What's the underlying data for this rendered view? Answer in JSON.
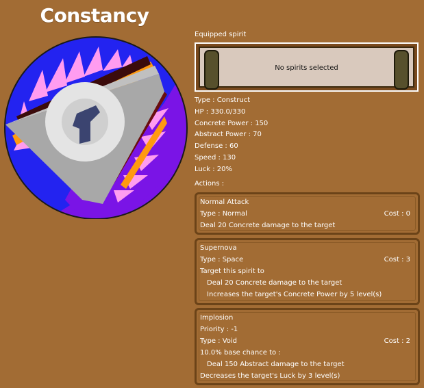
{
  "title": "Constancy",
  "equipped": {
    "label": "Equipped spirit",
    "empty_text": "No spirits selected"
  },
  "stats": {
    "type": "Type : Construct",
    "hp": "HP : 330.0/330",
    "concrete_power": "Concrete Power : 150",
    "abstract_power": "Abstract Power : 70",
    "defense": "Defense : 60",
    "speed": "Speed : 130",
    "luck": "Luck : 20%"
  },
  "actions_label": "Actions :",
  "actions": [
    {
      "name": "Normal Attack",
      "type": "Type : Normal",
      "cost": "Cost : 0",
      "description": "Deal 20 Concrete damage to the target"
    },
    {
      "name": "Supernova",
      "type": "Type : Space",
      "cost": "Cost : 3",
      "target": "Target this spirit to",
      "effect1": "Deal 20 Concrete damage to the target",
      "effect2": "Increases the target's Concrete Power by 5 level(s)"
    },
    {
      "name": "Implosion",
      "priority": "Priority : -1",
      "type": "Type : Void",
      "cost": "Cost : 2",
      "chance": "10.0% base chance to :",
      "effect1": "Deal 150 Abstract damage to the target",
      "effect2": "Decreases the target's Luck by 3 level(s)"
    }
  ],
  "colors": {
    "background": "#a26c34",
    "circle_blue": "#2323f0",
    "circle_purple": "#7a14e6",
    "spike_pink": "#ff9cf0",
    "stripe_orange": "#ff9a10",
    "shape_gray": "#a8a8a8",
    "shape_dark": "#3b4470"
  }
}
